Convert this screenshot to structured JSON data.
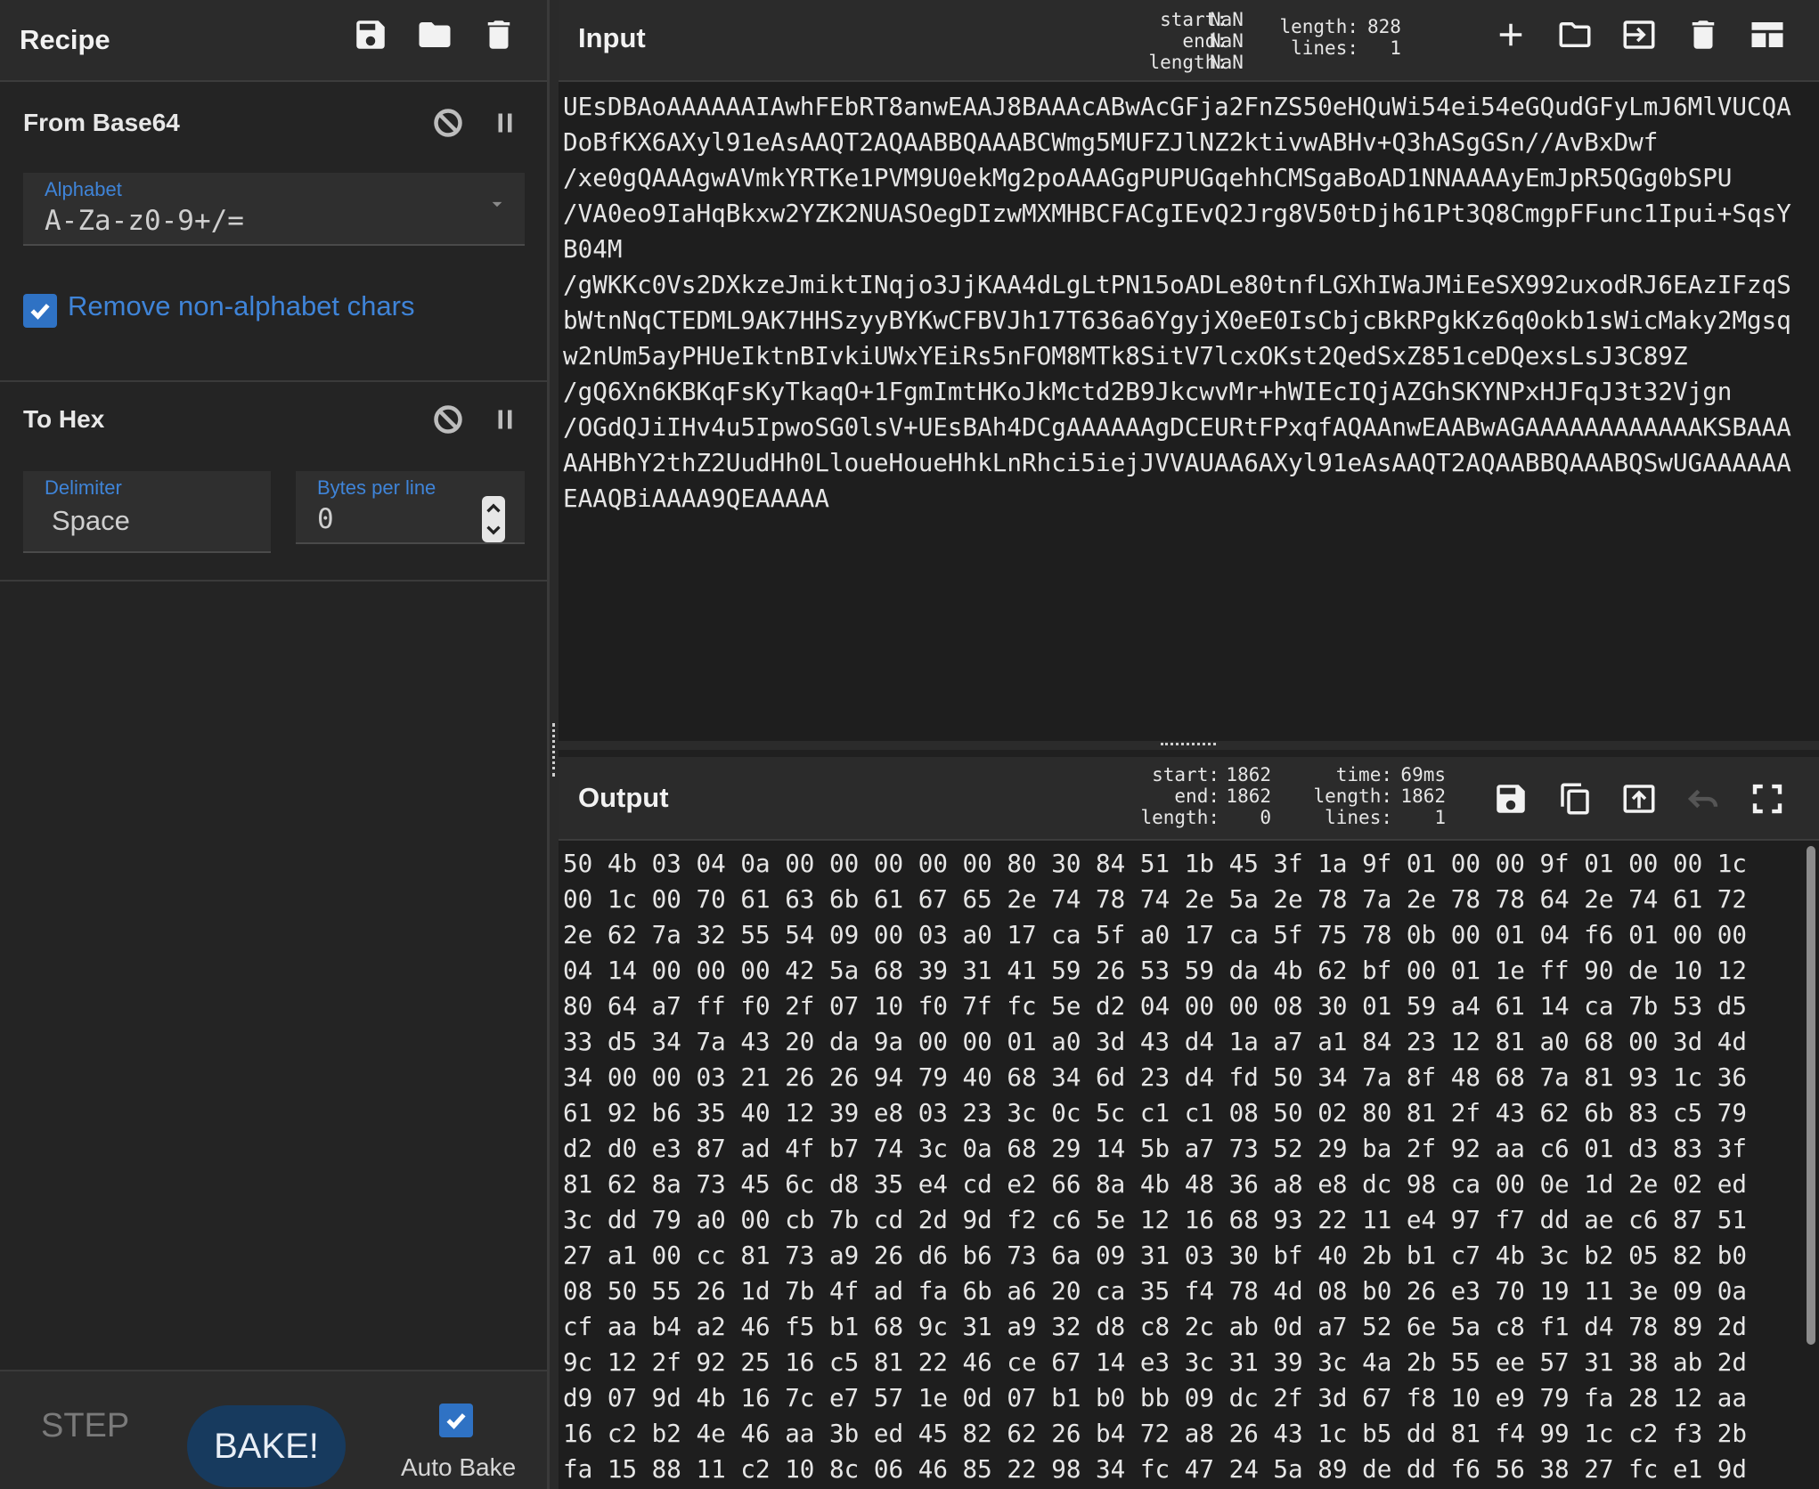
{
  "recipe": {
    "title": "Recipe",
    "operations": [
      {
        "name": "From Base64",
        "alphabet_label": "Alphabet",
        "alphabet_value": "A-Za-z0-9+/=",
        "remove_label": "Remove non-alphabet chars",
        "remove_checked": true
      },
      {
        "name": "To Hex",
        "delimiter_label": "Delimiter",
        "delimiter_value": "Space",
        "bytes_label": "Bytes per line",
        "bytes_value": "0"
      }
    ],
    "controls": {
      "step_label": "STEP",
      "bake_label": "BAKE!",
      "autobake_label": "Auto Bake",
      "autobake_checked": true
    }
  },
  "input": {
    "title": "Input",
    "sel_labels": "start:\n  end:\nlength:",
    "sel_values": "NaN\nNaN\nNaN",
    "info_labels": "length:\n lines:",
    "info_values": "828\n  1",
    "lines": [
      "UEsDBAoAAAAAAIAwhFEbRT8anwEAAJ8BAAAcABwAcGFja2FnZS50eHQuWi54ei54eGQudGFyLmJ6MlVUCQA",
      "DoBfKX6AXyl91eAsAAQT2AQAABBQAAABCWmg5MUFZJlNZ2ktivwABHv+Q3hASgGSn//AvBxDwf",
      "/xe0gQAAAgwAVmkYRTKe1PVM9U0ekMg2poAAAGgPUPUGqehhCMSgaBoAD1NNAAAAyEmJpR5QGg0bSPU",
      "/VA0eo9IaHqBkxw2YZK2NUASOegDIzwMXMHBCFACgIEvQ2Jrg8V50tDjh61Pt3Q8CmgpFFunc1Ipui+SqsY",
      "B04M",
      "/gWKKc0Vs2DXkzeJmiktINqjo3JjKAA4dLgLtPN15oADLe80tnfLGXhIWaJMiEeSX992uxodRJ6EAzIFzqS",
      "bWtnNqCTEDML9AK7HHSzyyBYKwCFBVJh17T636a6YgyjX0eE0IsCbjcBkRPgkKz6q0okb1sWicMaky2Mgsq",
      "w2nUm5ayPHUeIktnBIvkiUWxYEiRs5nFOM8MTk8SitV7lcxOKst2QedSxZ851ceDQexsLsJ3C89Z",
      "/gQ6Xn6KBKqFsKyTkaqO+1FgmImtHKoJkMctd2B9JkcwvMr+hWIEcIQjAZGhSKYNPxHJFqJ3t32Vjgn",
      "/OGdQJiIHv4u5IpwoSG0lsV+UEsBAh4DCgAAAAAAgDCEURtFPxqfAQAAnwEAABwAGAAAAAAAAAAAAKSBAAA",
      "AAHBhY2thZ2UudHh0LloueHoueHhkLnRhci5iejJVVAUAA6AXyl91eAsAAQT2AQAABBQAAABQSwUGAAAAAA",
      "EAAQBiAAAA9QEAAAAA"
    ]
  },
  "output": {
    "title": "Output",
    "sel_labels": " start:\n   end:\nlength:",
    "sel_values": "1862\n1862\n   0",
    "info_labels": "  time:\nlength:\n lines:",
    "info_values": "69ms\n1862\n   1",
    "lines": [
      "50 4b 03 04 0a 00 00 00 00 00 80 30 84 51 1b 45 3f 1a 9f 01 00 00 9f 01 00 00 1c",
      "00 1c 00 70 61 63 6b 61 67 65 2e 74 78 74 2e 5a 2e 78 7a 2e 78 78 64 2e 74 61 72",
      "2e 62 7a 32 55 54 09 00 03 a0 17 ca 5f a0 17 ca 5f 75 78 0b 00 01 04 f6 01 00 00",
      "04 14 00 00 00 42 5a 68 39 31 41 59 26 53 59 da 4b 62 bf 00 01 1e ff 90 de 10 12",
      "80 64 a7 ff f0 2f 07 10 f0 7f fc 5e d2 04 00 00 08 30 01 59 a4 61 14 ca 7b 53 d5",
      "33 d5 34 7a 43 20 da 9a 00 00 01 a0 3d 43 d4 1a a7 a1 84 23 12 81 a0 68 00 3d 4d",
      "34 00 00 03 21 26 26 94 79 40 68 34 6d 23 d4 fd 50 34 7a 8f 48 68 7a 81 93 1c 36",
      "61 92 b6 35 40 12 39 e8 03 23 3c 0c 5c c1 c1 08 50 02 80 81 2f 43 62 6b 83 c5 79",
      "d2 d0 e3 87 ad 4f b7 74 3c 0a 68 29 14 5b a7 73 52 29 ba 2f 92 aa c6 01 d3 83 3f",
      "81 62 8a 73 45 6c d8 35 e4 cd e2 66 8a 4b 48 36 a8 e8 dc 98 ca 00 0e 1d 2e 02 ed",
      "3c dd 79 a0 00 cb 7b cd 2d 9d f2 c6 5e 12 16 68 93 22 11 e4 97 f7 dd ae c6 87 51",
      "27 a1 00 cc 81 73 a9 26 d6 b6 73 6a 09 31 03 30 bf 40 2b b1 c7 4b 3c b2 05 82 b0",
      "08 50 55 26 1d 7b 4f ad fa 6b a6 20 ca 35 f4 78 4d 08 b0 26 e3 70 19 11 3e 09 0a",
      "cf aa b4 a2 46 f5 b1 68 9c 31 a9 32 d8 c8 2c ab 0d a7 52 6e 5a c8 f1 d4 78 89 2d",
      "9c 12 2f 92 25 16 c5 81 22 46 ce 67 14 e3 3c 31 39 3c 4a 2b 55 ee 57 31 38 ab 2d",
      "d9 07 9d 4b 16 7c e7 57 1e 0d 07 b1 b0 bb 09 dc 2f 3d 67 f8 10 e9 79 fa 28 12 aa",
      "16 c2 b2 4e 46 aa 3b ed 45 82 62 26 b4 72 a8 26 43 1c b5 dd 81 f4 99 1c c2 f3 2b",
      "fa 15 88 11 c2 10 8c 06 46 85 22 98 34 fc 47 24 5a 89 de dd f6 56 38 27 fc e1 9d"
    ]
  },
  "colors": {
    "accent": "#2f72c4",
    "bake_button": "#173a5e",
    "background": "#202020"
  },
  "icons": [
    "save-icon",
    "folder-icon",
    "trash-icon",
    "disable-icon",
    "pause-icon",
    "plus-icon",
    "import-icon",
    "layout-icon",
    "copy-icon",
    "replace-input-icon",
    "undo-icon",
    "maximise-icon",
    "spinner-icon",
    "dropdown-icon"
  ]
}
